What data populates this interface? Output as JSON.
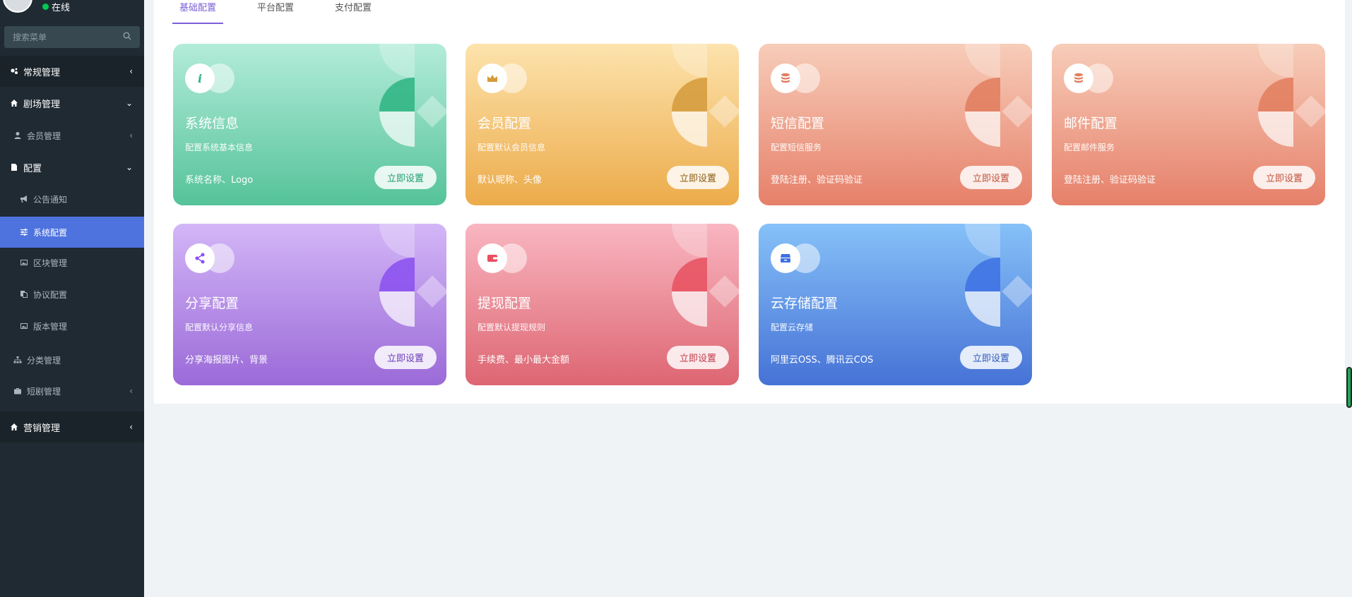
{
  "sidebar": {
    "status": "在线",
    "search_placeholder": "搜索菜单",
    "items": [
      {
        "label": "常规管理",
        "icon": "cogs-icon",
        "arrow": "‹"
      },
      {
        "label": "剧场管理",
        "icon": "home-icon",
        "arrow": "⌄"
      },
      {
        "label": "会员管理",
        "icon": "user-icon",
        "arrow": "‹"
      },
      {
        "label": "配置",
        "icon": "file-icon",
        "arrow": "⌄"
      },
      {
        "label": "公告通知",
        "icon": "bullhorn-icon"
      },
      {
        "label": "系统配置",
        "icon": "sliders-icon"
      },
      {
        "label": "区块管理",
        "icon": "image-icon"
      },
      {
        "label": "协议配置",
        "icon": "copy-icon"
      },
      {
        "label": "版本管理",
        "icon": "image-icon"
      },
      {
        "label": "分类管理",
        "icon": "sitemap-icon"
      },
      {
        "label": "短剧管理",
        "icon": "briefcase-icon",
        "arrow": "‹"
      },
      {
        "label": "营销管理",
        "icon": "home-icon",
        "arrow": "‹"
      }
    ]
  },
  "tabs": [
    "基础配置",
    "平台配置",
    "支付配置"
  ],
  "cards": [
    {
      "title": "系统信息",
      "desc": "配置系统基本信息",
      "features": "系统名称、Logo",
      "button": "立即设置",
      "icon": "info-icon",
      "color_top": "#b3ecda",
      "color_bottom": "#55c39a",
      "accent": "#2db483",
      "btn_color": "#1f9d6e"
    },
    {
      "title": "会员配置",
      "desc": "配置默认会员信息",
      "features": "默认昵称、头像",
      "button": "立即设置",
      "icon": "crown-icon",
      "color_top": "#fde3ad",
      "color_bottom": "#ecab4a",
      "accent": "#d59a3b",
      "btn_color": "#8a5a12"
    },
    {
      "title": "短信配置",
      "desc": "配置短信服务",
      "features": "登陆注册、验证码验证",
      "button": "立即设置",
      "icon": "database-icon",
      "color_top": "#f7cdb9",
      "color_bottom": "#e6806a",
      "accent": "#e27d5e",
      "btn_color": "#c0503a"
    },
    {
      "title": "邮件配置",
      "desc": "配置邮件服务",
      "features": "登陆注册、验证码验证",
      "button": "立即设置",
      "icon": "database-icon",
      "color_top": "#f7cdb9",
      "color_bottom": "#e6806a",
      "accent": "#e27d5e",
      "btn_color": "#c0503a"
    },
    {
      "title": "分享配置",
      "desc": "配置默认分享信息",
      "features": "分享海报图片、背景",
      "button": "立即设置",
      "icon": "share-icon",
      "color_top": "#d3b6f7",
      "color_bottom": "#9b6ad8",
      "accent": "#8a4ff0",
      "btn_color": "#6a3ab8"
    },
    {
      "title": "提现配置",
      "desc": "配置默认提现规则",
      "features": "手续费、最小最大金额",
      "button": "立即设置",
      "icon": "wallet-icon",
      "color_top": "#f9b6c1",
      "color_bottom": "#dd6672",
      "accent": "#e8505f",
      "btn_color": "#c03a48"
    },
    {
      "title": "云存储配置",
      "desc": "配置云存储",
      "features": "阿里云OSS、腾讯云COS",
      "button": "立即设置",
      "icon": "storage-icon",
      "color_top": "#86c1f8",
      "color_bottom": "#4672d6",
      "accent": "#3d71e3",
      "btn_color": "#2c58b8"
    }
  ]
}
